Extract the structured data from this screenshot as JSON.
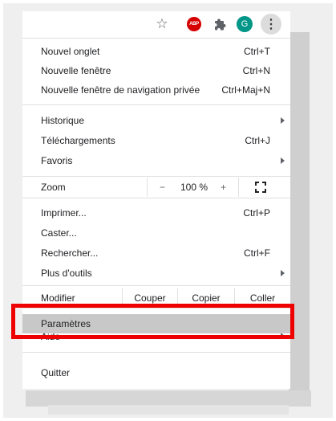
{
  "toolbar": {
    "icons": [
      "star-icon",
      "adblock-plus-icon",
      "extensions-puzzle-icon",
      "profile-avatar",
      "kebab-menu-icon"
    ],
    "abp_label": "ABP",
    "avatar_letter": "G",
    "kebab_glyph": "⋮",
    "star_glyph": "☆",
    "colors": {
      "abp": "#d50000",
      "avatar": "#009688",
      "kebab_bg": "#dcdcdc"
    }
  },
  "menu": {
    "new_tab": {
      "label": "Nouvel onglet",
      "shortcut": "Ctrl+T"
    },
    "new_window": {
      "label": "Nouvelle fenêtre",
      "shortcut": "Ctrl+N"
    },
    "new_incognito": {
      "label": "Nouvelle fenêtre de navigation privée",
      "shortcut": "Ctrl+Maj+N"
    },
    "history": {
      "label": "Historique",
      "has_submenu": true
    },
    "downloads": {
      "label": "Téléchargements",
      "shortcut": "Ctrl+J"
    },
    "bookmarks": {
      "label": "Favoris",
      "has_submenu": true
    },
    "zoom": {
      "label": "Zoom",
      "minus": "−",
      "value": "100 %",
      "plus": "+"
    },
    "print": {
      "label": "Imprimer...",
      "shortcut": "Ctrl+P"
    },
    "cast": {
      "label": "Caster..."
    },
    "find": {
      "label": "Rechercher...",
      "shortcut": "Ctrl+F"
    },
    "more_tools": {
      "label": "Plus d'outils",
      "has_submenu": true
    },
    "edit": {
      "label": "Modifier",
      "cut": "Couper",
      "copy": "Copier",
      "paste": "Coller"
    },
    "settings": {
      "label": "Paramètres",
      "highlighted": true
    },
    "help": {
      "label": "Aide",
      "has_submenu": true
    },
    "quit": {
      "label": "Quitter"
    }
  },
  "annotation": {
    "box_color": "#ef0000",
    "target": "settings"
  }
}
